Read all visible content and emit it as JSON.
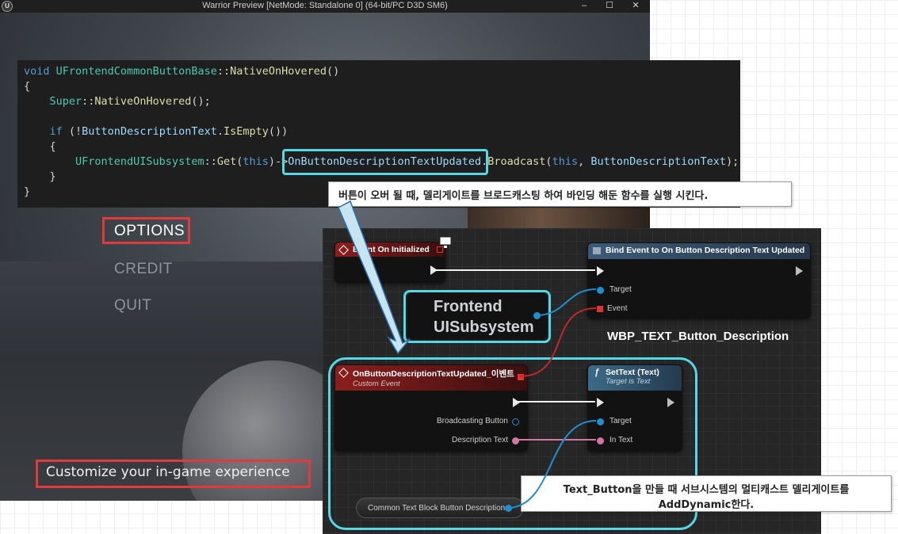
{
  "window": {
    "title": "Warrior Preview [NetMode: Standalone 0]  (64-bit/PC D3D SM6)",
    "logo": "ue-logo",
    "controls": [
      "–",
      "☐",
      "✕"
    ]
  },
  "menu": {
    "items": [
      {
        "label": "OPTIONS",
        "state": "hovered"
      },
      {
        "label": "CREDIT",
        "state": "normal"
      },
      {
        "label": "QUIT",
        "state": "normal"
      }
    ],
    "description": "Customize your in-game experience"
  },
  "code": {
    "lines": [
      {
        "parts": [
          [
            "kw",
            "void"
          ],
          [
            "",
            ""
          ],
          [
            "ty",
            "UFrontendCommonButtonBase"
          ],
          [
            "",
            "::"
          ],
          [
            "fn",
            "NativeOnHovered"
          ],
          [
            "",
            "()"
          ]
        ]
      },
      {
        "parts": [
          [
            "",
            "{"
          ]
        ]
      },
      {
        "parts": [
          [
            "ty",
            "    Super"
          ],
          [
            "",
            "::"
          ],
          [
            "fn",
            "NativeOnHovered"
          ],
          [
            "",
            "();"
          ]
        ]
      },
      {
        "parts": [
          [
            "",
            ""
          ]
        ]
      },
      {
        "parts": [
          [
            "kw",
            "    if"
          ],
          [
            "",
            " (!"
          ],
          [
            "id",
            "ButtonDescriptionText"
          ],
          [
            "",
            "."
          ],
          [
            "fn",
            "IsEmpty"
          ],
          [
            "",
            "())"
          ]
        ]
      },
      {
        "parts": [
          [
            "",
            "    {"
          ]
        ]
      },
      {
        "parts": [
          [
            "ty",
            "        UFrontendUISubsystem"
          ],
          [
            "",
            "::"
          ],
          [
            "fn",
            "Get"
          ],
          [
            "",
            "("
          ],
          [
            "kw",
            "this"
          ],
          [
            "",
            ")->"
          ],
          [
            "id",
            "OnButtonDescriptionTextUpdated"
          ],
          [
            "",
            "."
          ],
          [
            "fn",
            "Broadcast"
          ],
          [
            "",
            "("
          ],
          [
            "kw",
            "this"
          ],
          [
            "",
            ", "
          ],
          [
            "id",
            "ButtonDescriptionText"
          ],
          [
            "",
            ");"
          ]
        ]
      },
      {
        "parts": [
          [
            "",
            "    }"
          ]
        ]
      },
      {
        "parts": [
          [
            "",
            "}"
          ]
        ]
      }
    ]
  },
  "annotations": {
    "top_callout": "버튼이 오버 될 때, 델리게이트를 브로드캐스팅 하여 바인딩 해둔 함수를 실행 시킨다.",
    "bottom_callout_line1": "Text_Button을 만들 때 서브시스템의 멀티캐스트 델리게이트를",
    "bottom_callout_line2": "AddDynamic한다.",
    "accent_cyan": "#55d8e6",
    "accent_red": "#e23a3a"
  },
  "blueprint": {
    "event_init": {
      "title": "Event On Initialized"
    },
    "bind_event": {
      "title": "Bind Event to On Button Description Text Updated",
      "pins": [
        "Target",
        "Event"
      ]
    },
    "subsystem": {
      "line1": "Frontend",
      "line2": "UISubsystem"
    },
    "widget_name": "WBP_TEXT_Button_Description",
    "custom_event": {
      "title": "OnButtonDescriptionTextUpdated_이벤트",
      "subtitle": "Custom Event",
      "pins": [
        "Broadcasting Button",
        "Description Text"
      ]
    },
    "set_text": {
      "title": "SetText (Text)",
      "subtitle": "Target is Text",
      "pins": [
        "Target",
        "In Text"
      ]
    },
    "variable": {
      "label": "Common Text Block Button Description"
    }
  }
}
